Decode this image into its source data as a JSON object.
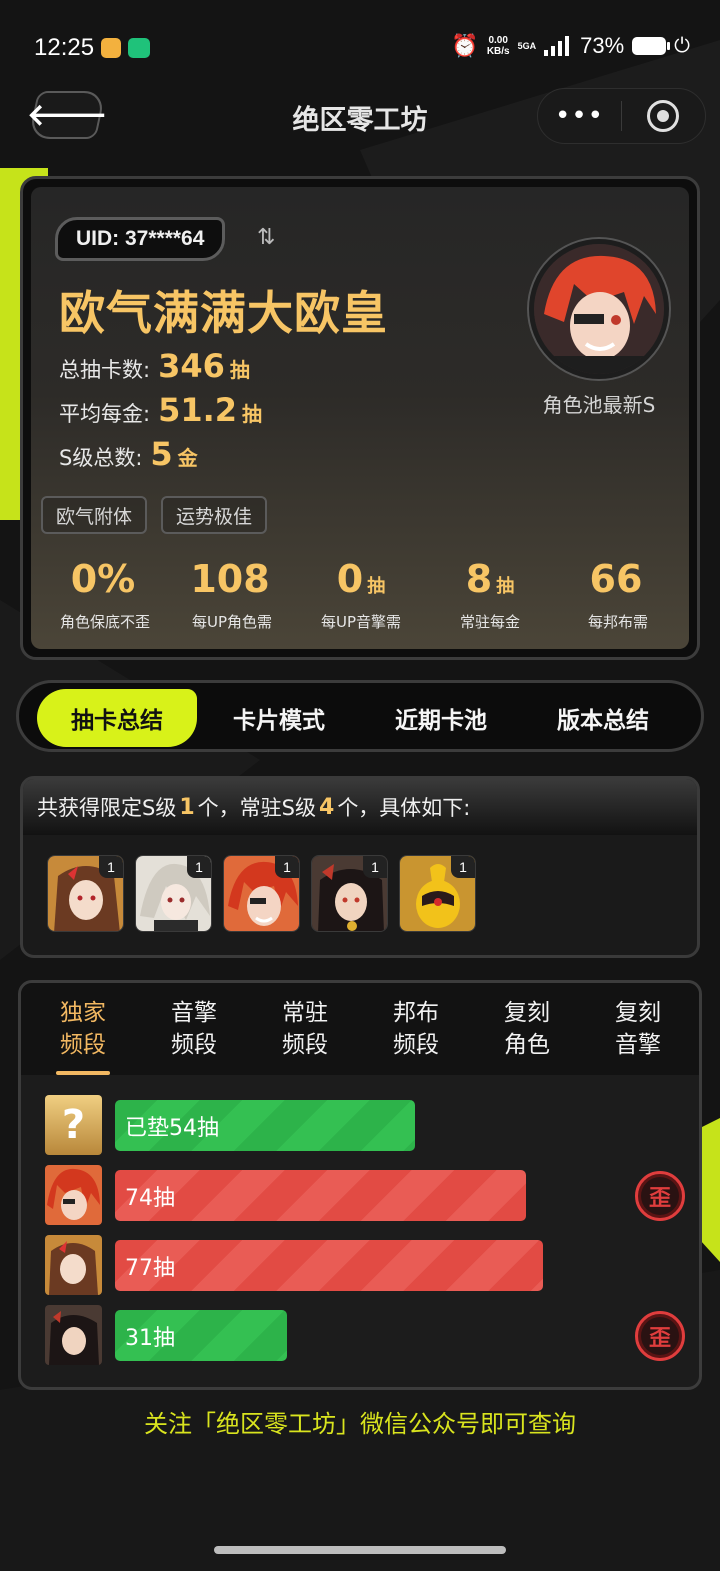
{
  "status": {
    "time": "12:25",
    "speed_top": "0.00",
    "speed_unit": "KB/s",
    "network": "5GA",
    "battery": "73%"
  },
  "nav": {
    "back_icon": "arrow-left-icon",
    "title": "绝区零工坊",
    "more_icon": "more-dots-icon",
    "target_icon": "target-icon"
  },
  "profile": {
    "uid": "UID: 37****64",
    "switch_icon": "⇅",
    "rank_title": "欧气满满大欧皇",
    "stats": [
      {
        "label": "总抽卡数:",
        "value": "346",
        "unit": "抽"
      },
      {
        "label": "平均每金:",
        "value": "51.2",
        "unit": "抽"
      },
      {
        "label": "S级总数:",
        "value": "5",
        "unit": "金"
      }
    ],
    "avatar_label": "角色池最新S",
    "tags": [
      "欧气附体",
      "运势极佳"
    ],
    "mini_stats": [
      {
        "value": "0%",
        "unit": "",
        "label": "角色保底不歪"
      },
      {
        "value": "108",
        "unit": "",
        "label": "每UP角色需"
      },
      {
        "value": "0",
        "unit": "抽",
        "label": "每UP音擎需"
      },
      {
        "value": "8",
        "unit": "抽",
        "label": "常驻每金"
      },
      {
        "value": "66",
        "unit": "",
        "label": "每邦布需"
      }
    ]
  },
  "tabs": [
    {
      "label": "抽卡总结",
      "active": true
    },
    {
      "label": "卡片模式",
      "active": false
    },
    {
      "label": "近期卡池",
      "active": false
    },
    {
      "label": "版本总结",
      "active": false
    }
  ],
  "summary": {
    "prefix": "共获得限定S级",
    "limited_count": "1",
    "middle": "个，常驻S级",
    "standard_count": "4",
    "suffix": "个，具体如下:",
    "characters": [
      {
        "name": "brown-hair-character",
        "count": "1"
      },
      {
        "name": "white-hair-character",
        "count": "1"
      },
      {
        "name": "red-hair-character",
        "count": "1"
      },
      {
        "name": "black-hair-character",
        "count": "1"
      },
      {
        "name": "yellow-bangboo",
        "count": "1"
      }
    ]
  },
  "pity": {
    "tabs": [
      {
        "line1": "独家",
        "line2": "频段",
        "active": true
      },
      {
        "line1": "音擎",
        "line2": "频段",
        "active": false
      },
      {
        "line1": "常驻",
        "line2": "频段",
        "active": false
      },
      {
        "line1": "邦布",
        "line2": "频段",
        "active": false
      },
      {
        "line1": "复刻",
        "line2": "角色",
        "active": false
      },
      {
        "line1": "复刻",
        "line2": "音擎",
        "active": false
      }
    ],
    "rows": [
      {
        "avatar": "question-mark",
        "label": "已垫54抽",
        "pulls": 54,
        "color": "green",
        "off_banner": false
      },
      {
        "avatar": "red-hair-character",
        "label": "74抽",
        "pulls": 74,
        "color": "red",
        "off_banner": true
      },
      {
        "avatar": "brown-hair-character",
        "label": "77抽",
        "pulls": 77,
        "color": "red",
        "off_banner": false
      },
      {
        "avatar": "black-hair-character",
        "label": "31抽",
        "pulls": 31,
        "color": "green",
        "off_banner": true
      }
    ],
    "question_glyph": "?",
    "off_banner_glyph": "歪"
  },
  "footer": {
    "tip": "关注「绝区零工坊」微信公众号即可查询"
  },
  "colors": {
    "accent": "#d8f219",
    "gold": "#f7c565",
    "green": "#2db34a",
    "red": "#e24b44",
    "footer": "#d9e41e"
  }
}
